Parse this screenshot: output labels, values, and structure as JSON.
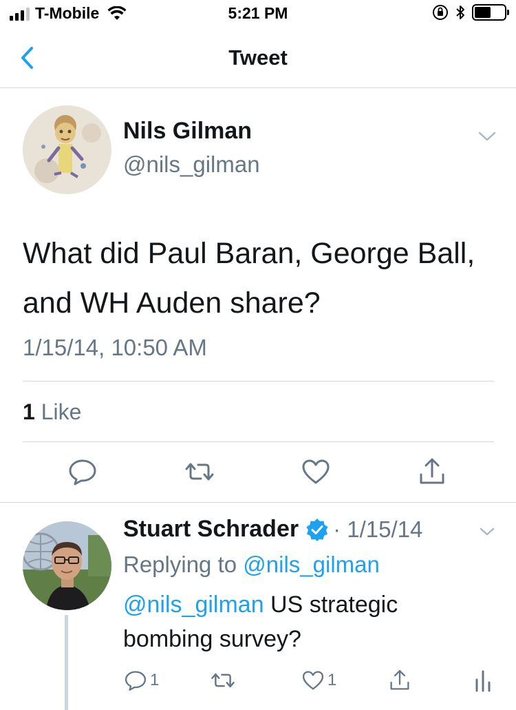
{
  "status_bar": {
    "carrier": "T-Mobile",
    "time": "5:21 PM",
    "signal_bars": 3,
    "signal_bars_total": 4,
    "battery_level": 0.55,
    "icons": [
      "wifi-icon",
      "orientation-lock-icon",
      "bluetooth-icon",
      "battery-icon"
    ]
  },
  "nav": {
    "title": "Tweet",
    "back_icon": "chevron-left-icon"
  },
  "tweet": {
    "name": "Nils Gilman",
    "handle": "@nils_gilman",
    "text": "What did Paul Baran, George Ball, and WH Auden share?",
    "timestamp": "1/15/14, 10:50 AM",
    "likes_count": "1",
    "likes_label": "Like",
    "actions": [
      "reply-icon",
      "retweet-icon",
      "like-icon",
      "share-icon"
    ]
  },
  "reply": {
    "name": "Stuart Schrader",
    "verified": true,
    "date": "· 1/15/14",
    "replying_prefix": "Replying to",
    "replying_to": "@nils_gilman",
    "mention": "@nils_gilman",
    "text": " US strategic bombing survey?",
    "reply_count": "1",
    "like_count": "1"
  },
  "colors": {
    "accent": "#1da1f2",
    "secondary_text": "#657786",
    "primary_text": "#14171a",
    "divider": "#d6d9dc"
  }
}
